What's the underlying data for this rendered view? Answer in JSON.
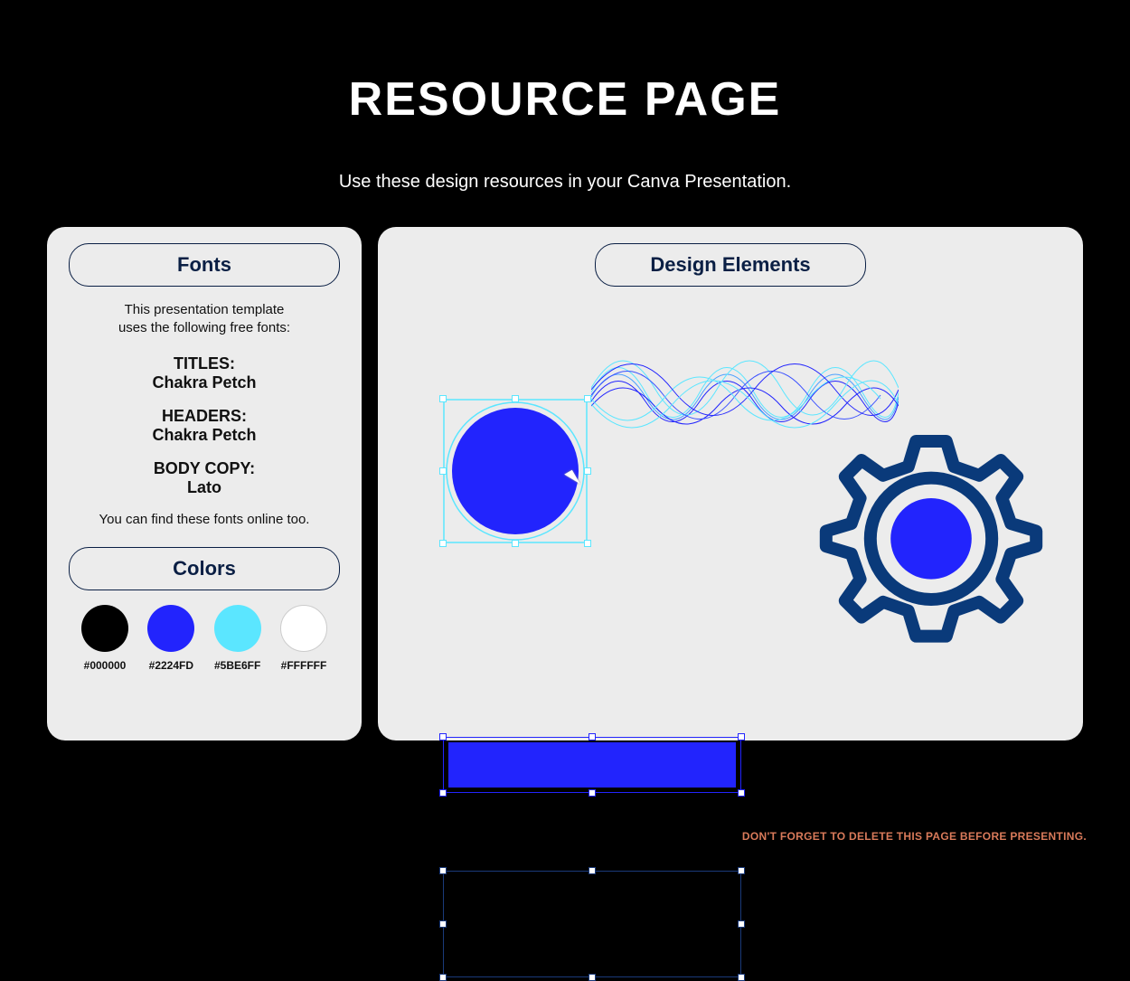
{
  "title": "RESOURCE PAGE",
  "subtitle": "Use these design resources in your Canva Presentation.",
  "fonts_card": {
    "heading": "Fonts",
    "intro_line1": "This presentation template",
    "intro_line2": "uses the following free fonts:",
    "titles_label": "TITLES:",
    "titles_font": "Chakra Petch",
    "headers_label": "HEADERS:",
    "headers_font": "Chakra Petch",
    "body_label": "BODY COPY:",
    "body_font": "Lato",
    "note": "You can find these fonts online too."
  },
  "colors_card": {
    "heading": "Colors",
    "swatches": [
      {
        "hex": "#000000",
        "fill": "#000000"
      },
      {
        "hex": "#2224FD",
        "fill": "#2224FD"
      },
      {
        "hex": "#5BE6FF",
        "fill": "#5BE6FF"
      },
      {
        "hex": "#FFFFFF",
        "fill": "#FFFFFF"
      }
    ]
  },
  "design_card": {
    "heading": "Design Elements"
  },
  "footer_warning": "DON'T FORGET TO DELETE THIS PAGE BEFORE PRESENTING.",
  "theme": {
    "bg": "#000000",
    "card": "#ececec",
    "navy": "#0a1f44",
    "primary": "#2224FD",
    "cyan": "#5BE6FF"
  }
}
